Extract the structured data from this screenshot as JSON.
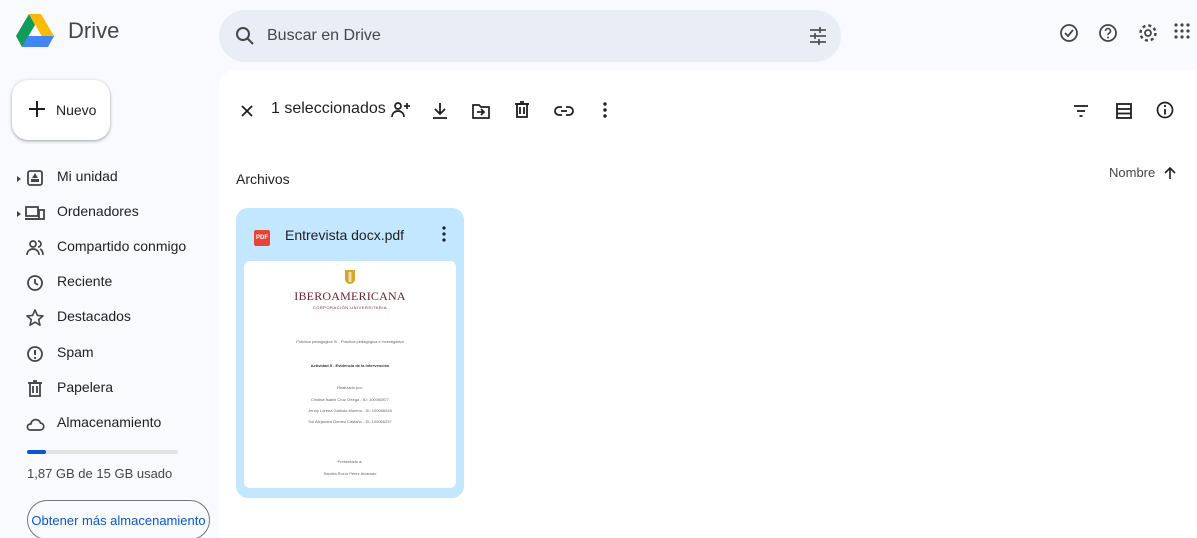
{
  "header": {
    "app_name": "Drive",
    "search_placeholder": "Buscar en Drive",
    "icons": [
      "drive-logo",
      "search-icon",
      "tune-icon",
      "offline-status-icon",
      "help-icon",
      "settings-icon",
      "apps-grid-icon"
    ]
  },
  "sidebar": {
    "new_label": "Nuevo",
    "items": [
      {
        "label": "Mi unidad",
        "icon": "my-drive-icon",
        "expandable": true
      },
      {
        "label": "Ordenadores",
        "icon": "computers-icon",
        "expandable": true
      },
      {
        "label": "Compartido conmigo",
        "icon": "shared-icon",
        "expandable": false
      },
      {
        "label": "Reciente",
        "icon": "clock-icon",
        "expandable": false
      },
      {
        "label": "Destacados",
        "icon": "star-icon",
        "expandable": false
      },
      {
        "label": "Spam",
        "icon": "spam-icon",
        "expandable": false
      },
      {
        "label": "Papelera",
        "icon": "trash-icon",
        "expandable": false
      },
      {
        "label": "Almacenamiento",
        "icon": "cloud-icon",
        "expandable": false
      }
    ],
    "storage": {
      "used_fraction": 0.125,
      "text": "1,87 GB de 15 GB usado",
      "more_label": "Obtener más almacenamiento"
    }
  },
  "toolbar": {
    "selection_text": "1 seleccionados",
    "icons": [
      "close-icon",
      "share-person-icon",
      "download-icon",
      "move-to-folder-icon",
      "trash-icon",
      "link-icon",
      "more-vert-icon",
      "filter-icon",
      "list-view-icon",
      "info-icon"
    ]
  },
  "content": {
    "section_title": "Archivos",
    "sort_label": "Nombre",
    "files": [
      {
        "name": "Entrevista docx.pdf",
        "type_badge": "PDF",
        "thumbnail": {
          "brand": "IBEROAMERICANA",
          "brand_sub": "CORPORACIÓN UNIVERSITARIA",
          "lines": [
            "Práctica pedagógica IV - Práctica pedagógica e investigativa",
            "Actividad 5 - Evidencia de la intervención",
            "Realizado por:",
            "Cristina Isabel Cruz Ortega - ID: 100060877",
            "Jenny Lorena Galindo Moreno - ID: 100066045",
            "Sol Alejandra Gómez Castaño - ID: 100066297",
            "Presentado a:",
            "Sandra Rocío Pérez Alvarado"
          ]
        }
      }
    ]
  },
  "colors": {
    "background": "#f8fafd",
    "search_bg": "#e9eef6",
    "selected_card": "#c2e7ff",
    "accent": "#0b57d0",
    "pdf_red": "#ea4335"
  }
}
